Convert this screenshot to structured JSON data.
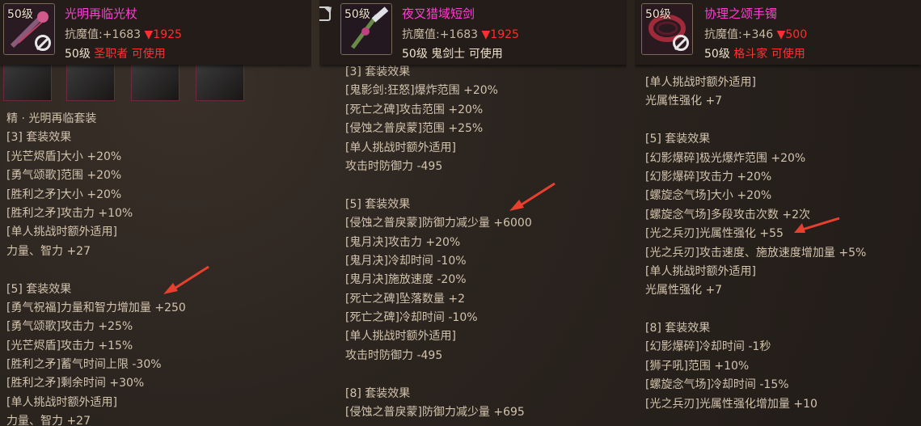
{
  "columns": [
    {
      "level_badge": "50级",
      "name": "光明再临光杖",
      "stat_label": "抗魔值:",
      "stat_value": "+1683",
      "stat_diff": "▼1925",
      "req_level": "50级",
      "req_class": "圣职者",
      "req_status": "可使用",
      "lines": [
        "精 · 光明再临套装",
        "[3] 套装效果",
        "[光芒烬盾]大小 +20%",
        "[勇气颂歌]范围 +20%",
        "[胜利之矛]大小 +20%",
        "[胜利之矛]攻击力 +10%",
        "[单人挑战时额外适用]",
        "力量、智力 +27",
        "",
        "[5] 套装效果",
        "[勇气祝福]力量和智力增加量 +250",
        "[勇气颂歌]攻击力 +25%",
        "[光芒烬盾]攻击力 +15%",
        "[胜利之矛]蓄气时间上限 -30%",
        "[胜利之矛]剩余时间 +30%",
        "[单人挑战时额外适用]",
        "力量、智力 +27"
      ]
    },
    {
      "level_badge": "50级",
      "name": "夜叉猎域短剑",
      "stat_label": "抗魔值:",
      "stat_value": "+1683",
      "stat_diff": "▼1925",
      "req_level": "50级",
      "req_class": "鬼剑士",
      "req_status": "可使用",
      "lines": [
        "[3] 套装效果",
        "[鬼影剑:狂怒]爆炸范围 +20%",
        "[死亡之碑]攻击范围 +20%",
        "[侵蚀之普戾蒙]范围 +25%",
        "[单人挑战时额外适用]",
        "攻击时防御力 -495",
        "",
        "[5] 套装效果",
        "[侵蚀之普戾蒙]防御力减少量 +6000",
        "[鬼月决]攻击力 +20%",
        "[鬼月决]冷却时间 -10%",
        "[鬼月决]施放速度 -20%",
        "[死亡之碑]坠落数量 +2",
        "[死亡之碑]冷却时间 -10%",
        "[单人挑战时额外适用]",
        "攻击时防御力 -495",
        "",
        "[8] 套装效果",
        "[侵蚀之普戾蒙]防御力减少量 +695"
      ]
    },
    {
      "level_badge": "50级",
      "name": "协理之颂手镯",
      "stat_label": "抗魔值:",
      "stat_value": "+346",
      "stat_diff": "▼500",
      "req_level": "50级",
      "req_class": "格斗家",
      "req_status": "可使用",
      "lines": [
        "[单人挑战时额外适用]",
        "光属性强化 +7",
        "",
        "[5] 套装效果",
        "[幻影爆碎]极光爆炸范围 +20%",
        "[幻影爆碎]攻击力 +20%",
        "[螺旋念气场]大小 +20%",
        "[螺旋念气场]多段攻击次数 +2次",
        "[光之兵刃]光属性强化 +55",
        "[光之兵刃]攻击速度、施放速度增加量 +5%",
        "[单人挑战时额外适用]",
        "光属性强化 +7",
        "",
        "[8] 套装效果",
        "[幻影爆碎]冷却时间 -1秒",
        "[狮子吼]范围 +10%",
        "[螺旋念气场]冷却时间 -15%",
        "[光之兵刃]光属性强化增加量 +10"
      ]
    }
  ],
  "colors": {
    "item_name": "#ff3fd3",
    "stat_down": "#ff2e2e",
    "class_req": "#ff3232",
    "text": "#d2c3ad",
    "arrow": "#e8402f"
  }
}
